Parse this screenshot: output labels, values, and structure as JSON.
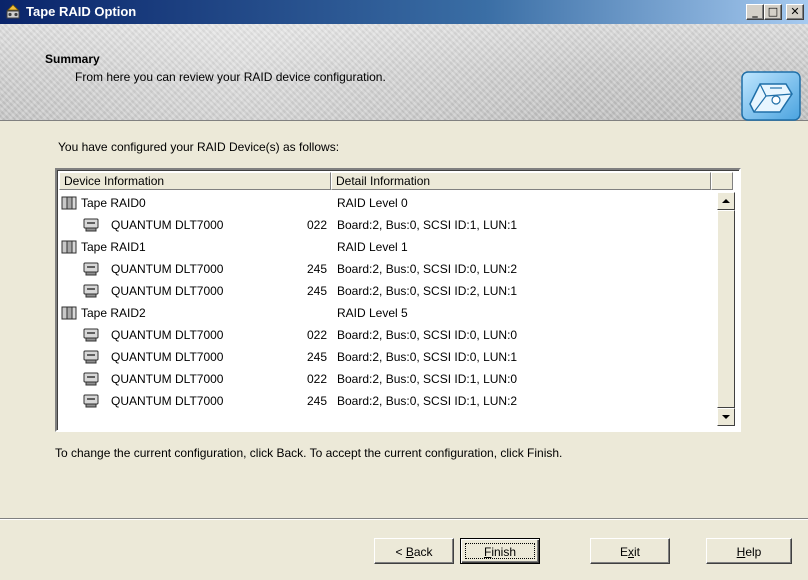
{
  "window": {
    "title": "Tape RAID Option",
    "controls": [
      "minimize-icon",
      "maximize-icon",
      "close-icon"
    ]
  },
  "header": {
    "title": "Summary",
    "subtitle": "From here you can review your RAID device configuration."
  },
  "intro": "You have configured your RAID Device(s) as follows:",
  "list": {
    "columns": [
      "Device Information",
      "Detail Information"
    ],
    "rows": [
      {
        "type": "group",
        "icon": "tape-raid-group-icon",
        "name": "Tape RAID0",
        "fw": "",
        "detail": "RAID Level  0"
      },
      {
        "type": "device",
        "icon": "tape-drive-icon",
        "name": "QUANTUM DLT7000",
        "fw": "022",
        "detail": "Board:2, Bus:0, SCSI ID:1, LUN:1"
      },
      {
        "type": "group",
        "icon": "tape-raid-group-icon",
        "name": "Tape RAID1",
        "fw": "",
        "detail": "RAID Level  1"
      },
      {
        "type": "device",
        "icon": "tape-drive-icon",
        "name": "QUANTUM DLT7000",
        "fw": "245",
        "detail": "Board:2, Bus:0, SCSI ID:0, LUN:2"
      },
      {
        "type": "device",
        "icon": "tape-drive-icon",
        "name": "QUANTUM DLT7000",
        "fw": "245",
        "detail": "Board:2, Bus:0, SCSI ID:2, LUN:1"
      },
      {
        "type": "group",
        "icon": "tape-raid-group-icon",
        "name": "Tape RAID2",
        "fw": "",
        "detail": "RAID Level  5"
      },
      {
        "type": "device",
        "icon": "tape-drive-icon",
        "name": "QUANTUM DLT7000",
        "fw": "022",
        "detail": "Board:2, Bus:0, SCSI ID:0, LUN:0"
      },
      {
        "type": "device",
        "icon": "tape-drive-icon",
        "name": "QUANTUM DLT7000",
        "fw": "245",
        "detail": "Board:2, Bus:0, SCSI ID:0, LUN:1"
      },
      {
        "type": "device",
        "icon": "tape-drive-icon",
        "name": "QUANTUM DLT7000",
        "fw": "022",
        "detail": "Board:2, Bus:0, SCSI ID:1, LUN:0"
      },
      {
        "type": "device",
        "icon": "tape-drive-icon",
        "name": "QUANTUM DLT7000",
        "fw": "245",
        "detail": "Board:2, Bus:0, SCSI ID:1, LUN:2"
      }
    ]
  },
  "footer": "To change the current configuration, click Back. To accept the current configuration, click Finish.",
  "buttons": {
    "back": {
      "pre": "< ",
      "accel": "B",
      "post": "ack"
    },
    "finish": {
      "pre": "",
      "accel": "F",
      "post": "inish"
    },
    "exit": {
      "pre": "E",
      "accel": "x",
      "post": "it"
    },
    "help": {
      "pre": "",
      "accel": "H",
      "post": "elp"
    }
  },
  "colors": {
    "titlebar_start": "#0a246a",
    "titlebar_end": "#a6caf0",
    "face": "#ece9d8"
  }
}
